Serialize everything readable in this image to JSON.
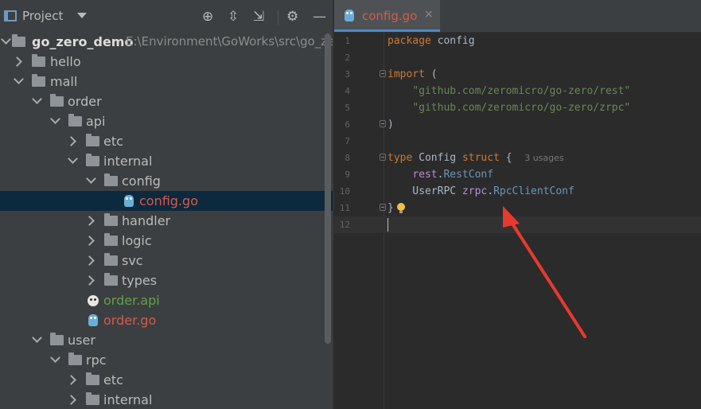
{
  "project_panel": {
    "title": "Project",
    "toolbar_icons": [
      "locate-icon",
      "expand-all-icon",
      "collapse-all-icon",
      "settings-icon",
      "minimize-icon"
    ],
    "root": {
      "name": "go_zero_demo",
      "path": "E:\\Environment\\GoWorks\\src\\go_ze"
    },
    "tree": [
      {
        "label": "hello",
        "kind": "folder",
        "expanded": false
      },
      {
        "label": "mall",
        "kind": "folder",
        "expanded": true
      },
      {
        "label": "order",
        "kind": "folder",
        "expanded": true
      },
      {
        "label": "api",
        "kind": "folder",
        "expanded": true
      },
      {
        "label": "etc",
        "kind": "folder",
        "expanded": false
      },
      {
        "label": "internal",
        "kind": "folder",
        "expanded": true
      },
      {
        "label": "config",
        "kind": "folder",
        "expanded": true
      },
      {
        "label": "config.go",
        "kind": "go-file",
        "selected": true
      },
      {
        "label": "handler",
        "kind": "folder",
        "expanded": false
      },
      {
        "label": "logic",
        "kind": "folder",
        "expanded": false
      },
      {
        "label": "svc",
        "kind": "folder",
        "expanded": false
      },
      {
        "label": "types",
        "kind": "folder",
        "expanded": false
      },
      {
        "label": "order.api",
        "kind": "api-file"
      },
      {
        "label": "order.go",
        "kind": "go-file"
      },
      {
        "label": "user",
        "kind": "folder",
        "expanded": true
      },
      {
        "label": "rpc",
        "kind": "folder",
        "expanded": true
      },
      {
        "label": "etc",
        "kind": "folder",
        "expanded": false
      },
      {
        "label": "internal",
        "kind": "folder",
        "expanded": false
      }
    ]
  },
  "editor": {
    "tab": {
      "label": "config.go",
      "close": "×"
    },
    "lines": [
      {
        "num": "1",
        "tokens": [
          [
            "kw",
            "package"
          ],
          [
            "plain",
            " config"
          ]
        ]
      },
      {
        "num": "2",
        "tokens": []
      },
      {
        "num": "3",
        "tokens": [
          [
            "kw",
            "import"
          ],
          [
            "plain",
            " ("
          ]
        ]
      },
      {
        "num": "4",
        "tokens": [
          [
            "plain",
            "    "
          ],
          [
            "str",
            "\"github.com/zeromicro/go-zero/rest\""
          ]
        ]
      },
      {
        "num": "5",
        "tokens": [
          [
            "plain",
            "    "
          ],
          [
            "str",
            "\"github.com/zeromicro/go-zero/zrpc\""
          ]
        ]
      },
      {
        "num": "6",
        "tokens": [
          [
            "plain",
            ")"
          ]
        ]
      },
      {
        "num": "7",
        "tokens": []
      },
      {
        "num": "8",
        "tokens": [
          [
            "kw",
            "type"
          ],
          [
            "plain",
            " Config "
          ],
          [
            "kw",
            "struct"
          ],
          [
            "plain",
            " {  "
          ],
          [
            "hint",
            "3 usages"
          ]
        ]
      },
      {
        "num": "9",
        "tokens": [
          [
            "plain",
            "    "
          ],
          [
            "pkg",
            "rest"
          ],
          [
            "plain",
            "."
          ],
          [
            "typ",
            "RestConf"
          ]
        ]
      },
      {
        "num": "10",
        "tokens": [
          [
            "plain",
            "    UserRPC "
          ],
          [
            "pkg",
            "zrpc"
          ],
          [
            "plain",
            "."
          ],
          [
            "typ",
            "RpcClientConf"
          ]
        ]
      },
      {
        "num": "11",
        "tokens": [
          [
            "plain",
            "}"
          ]
        ]
      },
      {
        "num": "12",
        "tokens": []
      }
    ]
  },
  "colors": {
    "accent_tab_underline": "#4a88c7",
    "annotation_arrow": "#e8392f",
    "selected_row": "#0d293e"
  }
}
